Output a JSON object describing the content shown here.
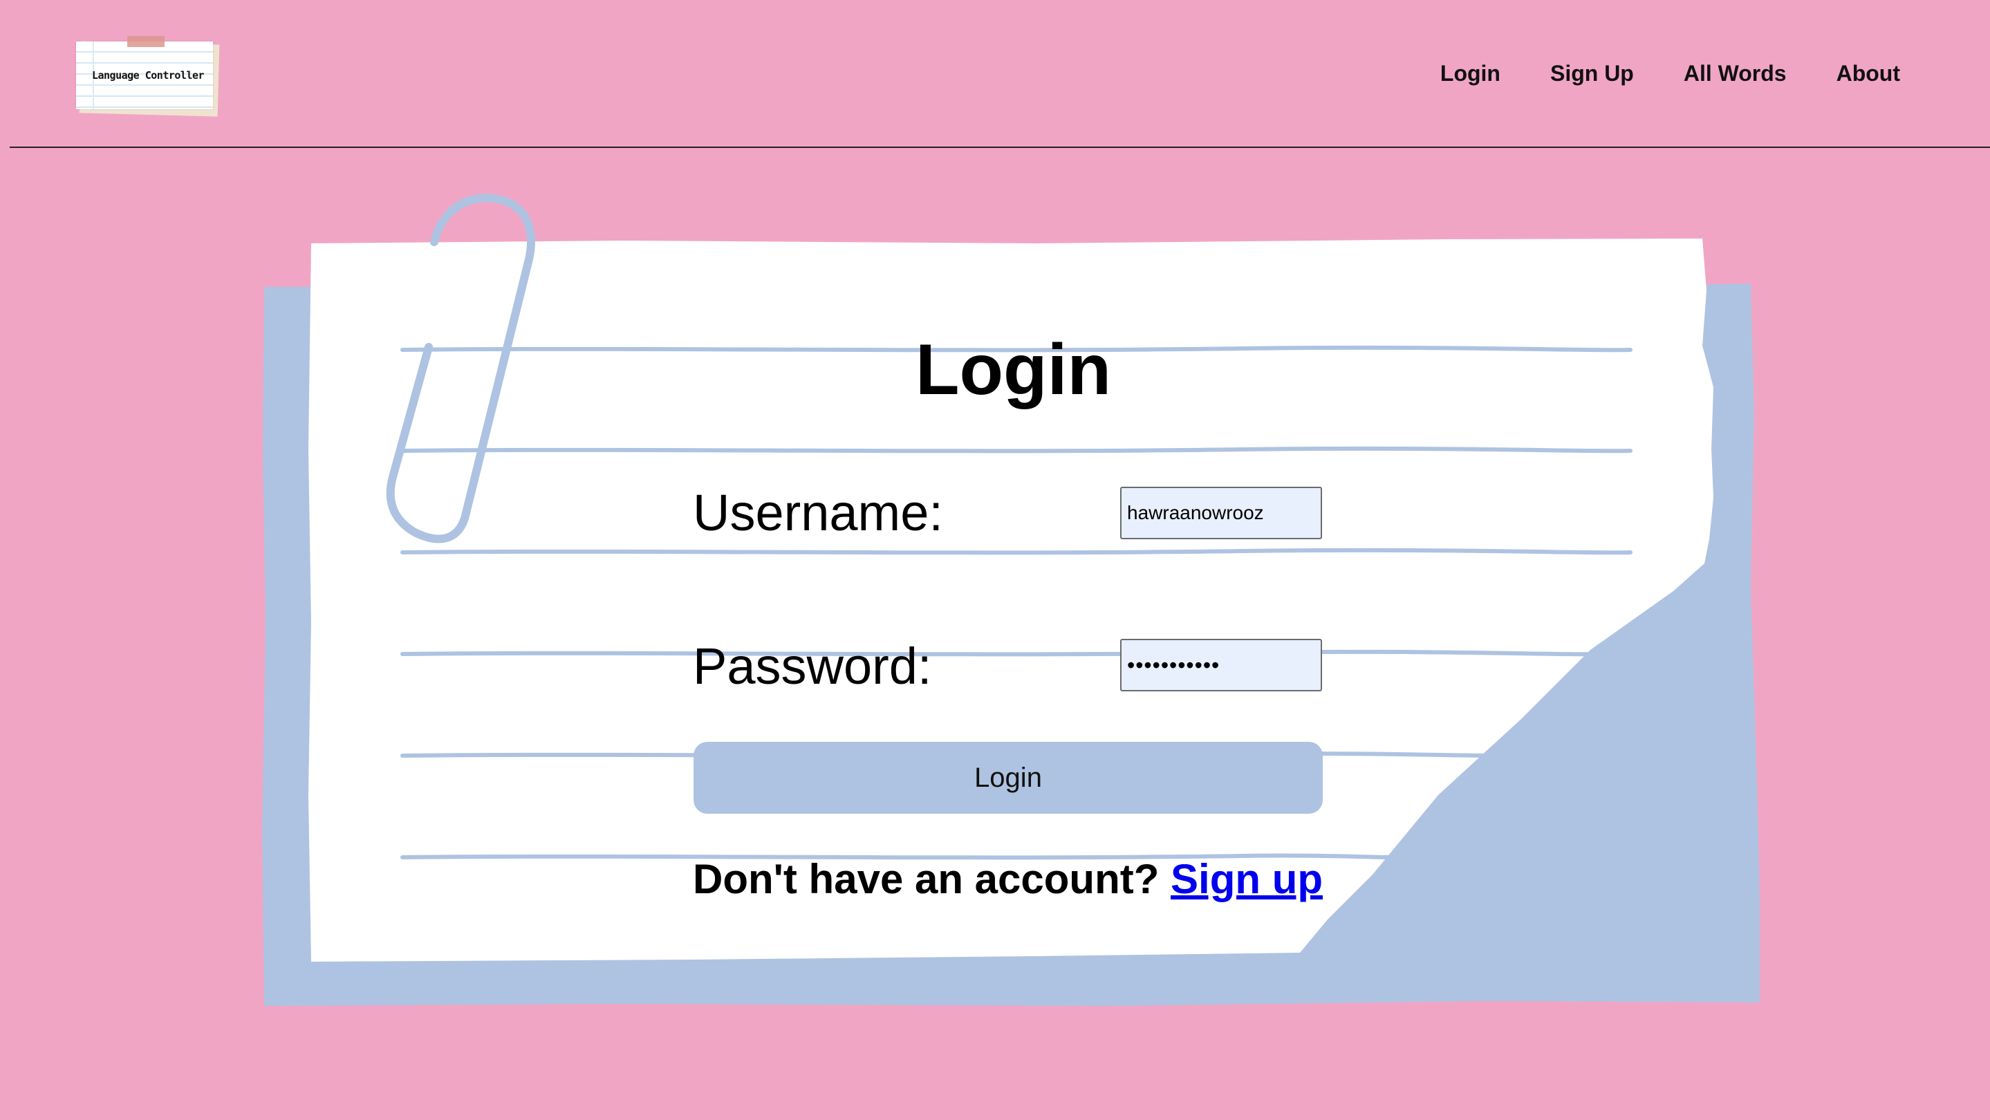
{
  "header": {
    "logo_text": "Language Controller",
    "nav": {
      "login": "Login",
      "signup": "Sign Up",
      "all_words": "All Words",
      "about": "About"
    }
  },
  "form": {
    "title": "Login",
    "username_label": "Username:",
    "username_value": "hawraanowrooz",
    "password_label": "Password:",
    "password_value": "•••••••••••",
    "submit_label": "Login",
    "no_account_text": "Don't have an account?",
    "signup_link": "Sign up"
  },
  "colors": {
    "background": "#f1a5c5",
    "card_shadow": "#aec3e1",
    "paper": "#ffffff",
    "accent_button": "#aec3e1",
    "input_bg": "#e8effd",
    "link": "#0000ee"
  },
  "icons": [
    "paperclip-icon"
  ]
}
